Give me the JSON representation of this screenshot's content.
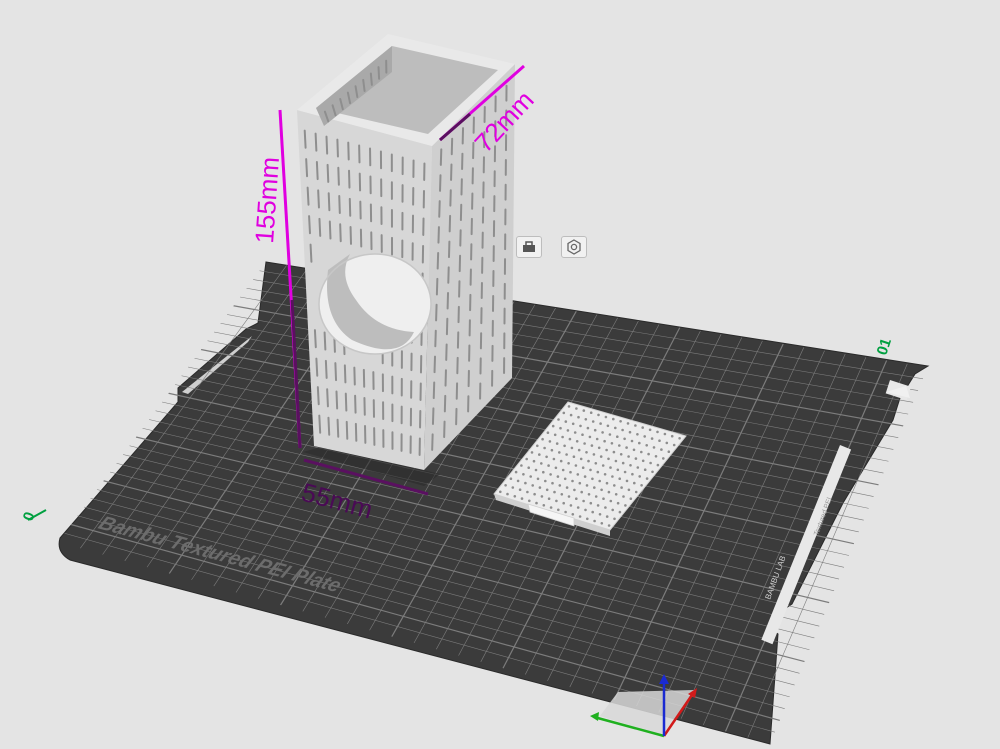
{
  "plate": {
    "name": "Bambu Textured PEI Plate",
    "plate_number": "01",
    "origin_label": "0",
    "side_label": "BAMBU LAB",
    "bottom_right_label": "Textured PEI"
  },
  "dimensions": {
    "height": "155mm",
    "depth": "72mm",
    "width": "55mm"
  },
  "plate_tools": [
    {
      "name": "lock-icon"
    },
    {
      "name": "settings-icon"
    }
  ],
  "colors": {
    "background": "#e4e4e4",
    "plate": "#3b3b3b",
    "grid_line": "#8a8a8a",
    "model": "#d9d9d9",
    "measure_line": "#e000e0",
    "plate_number": "#00a040",
    "axis_x": "#d21a1a",
    "axis_y": "#1fb01f",
    "axis_z": "#1a2ad2"
  }
}
